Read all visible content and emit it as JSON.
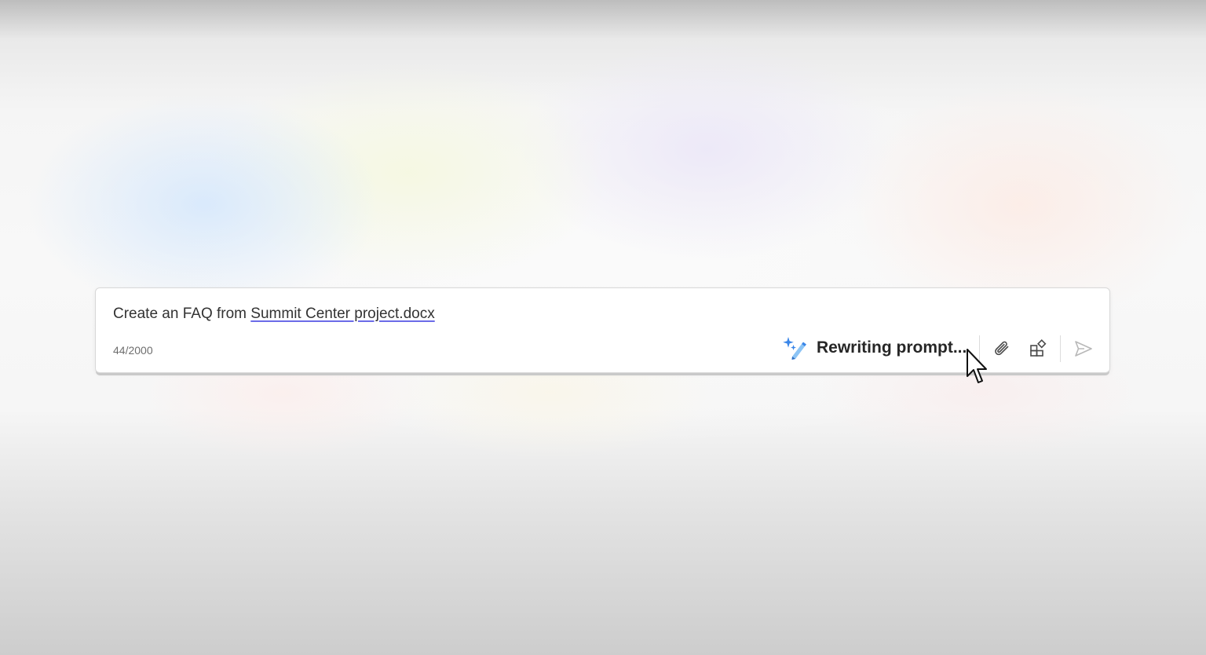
{
  "composer": {
    "prompt_prefix": "Create an FAQ from ",
    "file_reference": "Summit Center project.docx",
    "char_count": "44/2000",
    "rewrite_status": "Rewriting prompt..."
  },
  "icons": {
    "rewrite": "sparkle-pen-icon",
    "attach": "paperclip-icon",
    "apps": "apps-grid-icon",
    "send": "send-icon"
  },
  "colors": {
    "file_underline": "#6b6be8",
    "sparkle_blue": "#3a86e8",
    "sparkle_light": "#8cc4f5"
  }
}
